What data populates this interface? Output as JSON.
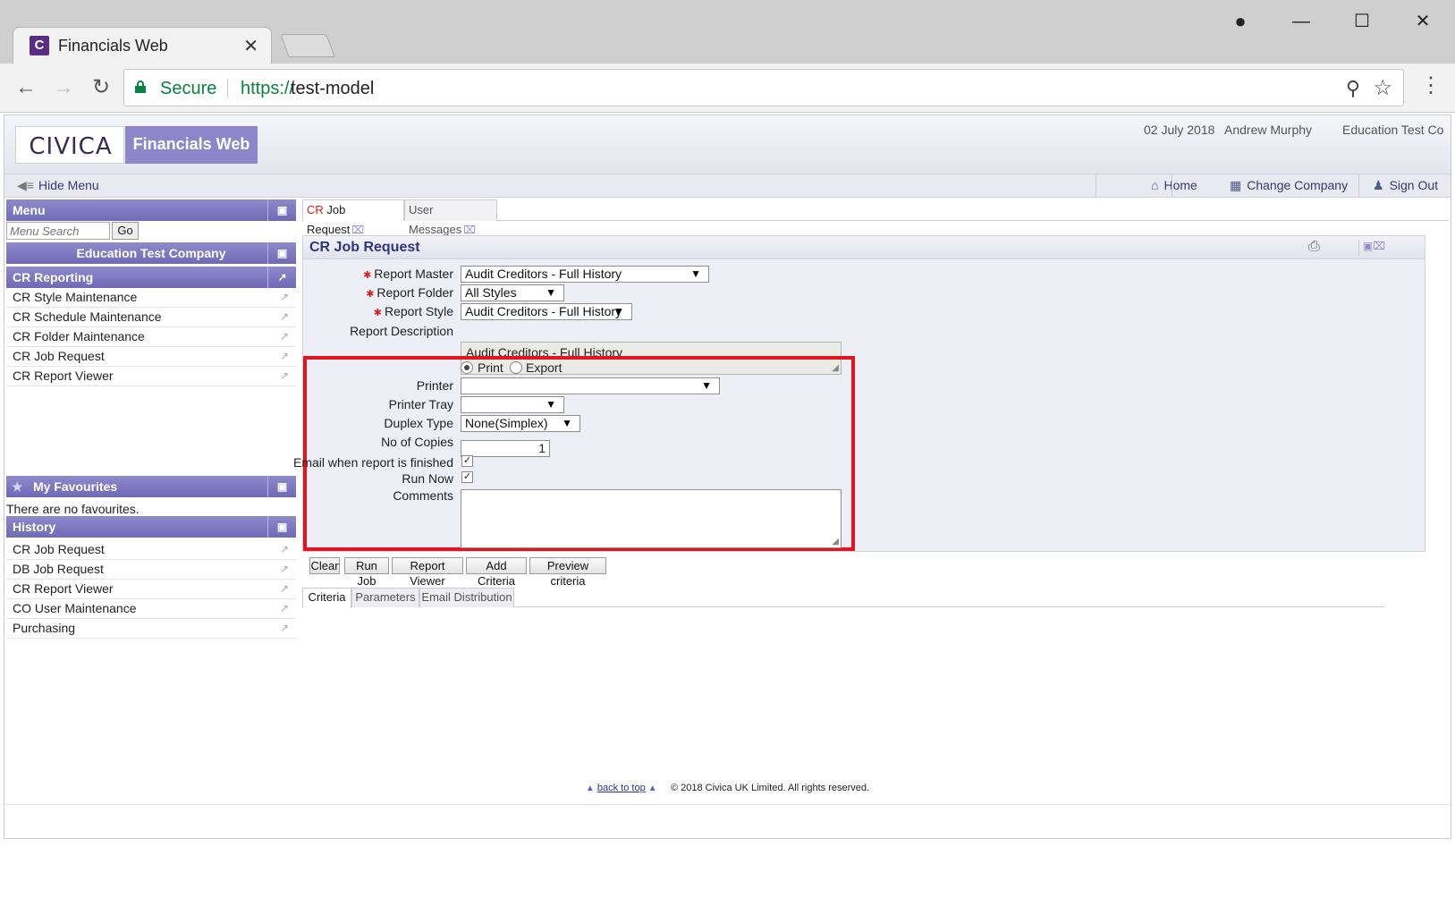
{
  "browser": {
    "tab_title": "Financials Web",
    "favicon_letter": "C",
    "close_glyph": "✕",
    "secure_label": "Secure",
    "url_scheme": "https://",
    "url_host": "test-model"
  },
  "header": {
    "logo_text": "CIVICA",
    "product_name": "Financials Web",
    "date": "02 July 2018",
    "user": "Andrew Murphy",
    "company": "Education Test Co"
  },
  "toolbar": {
    "hide_menu": "Hide Menu",
    "home": "Home",
    "change_company": "Change Company",
    "sign_out": "Sign Out"
  },
  "sidebar": {
    "menu_title": "Menu",
    "search_placeholder": "Menu Search",
    "go_label": "Go",
    "company_title": "Education Test Company",
    "section_title": "CR Reporting",
    "items": [
      {
        "label": "CR Style Maintenance"
      },
      {
        "label": "CR Schedule Maintenance"
      },
      {
        "label": "CR Folder Maintenance"
      },
      {
        "label": "CR Job Request"
      },
      {
        "label": "CR Report Viewer"
      }
    ],
    "favourites_title": "My Favourites",
    "favourites_empty": "There are no favourites.",
    "history_title": "History",
    "history": [
      {
        "label": "CR Job Request"
      },
      {
        "label": "DB Job Request"
      },
      {
        "label": "CR Report Viewer"
      },
      {
        "label": "CO User Maintenance"
      },
      {
        "label": "Purchasing"
      }
    ]
  },
  "content": {
    "tabs": [
      {
        "prefix": "CR",
        "label": " Job Request"
      },
      {
        "label": "User Messages"
      }
    ],
    "panel_title": "CR Job Request",
    "form": {
      "report_master_label": "Report Master",
      "report_master_value": "Audit Creditors - Full History",
      "report_folder_label": "Report Folder",
      "report_folder_value": "All Styles",
      "report_style_label": "Report Style",
      "report_style_value": "Audit Creditors - Full History",
      "report_description_label": "Report Description",
      "report_description_value": "Audit Creditors - Full History",
      "output_print": "Print",
      "output_export": "Export",
      "output_selected": "Print",
      "printer_label": "Printer",
      "printer_value": "",
      "printer_tray_label": "Printer Tray",
      "printer_tray_value": "",
      "duplex_label": "Duplex Type",
      "duplex_value": "None(Simplex)",
      "copies_label": "No of Copies",
      "copies_value": "1",
      "email_label": "Email when report is finished",
      "email_checked": true,
      "run_now_label": "Run Now",
      "run_now_checked": true,
      "comments_label": "Comments",
      "comments_value": ""
    },
    "actions": [
      "Clear",
      "Run Job",
      "Report Viewer",
      "Add Criteria",
      "Preview criteria"
    ],
    "sub_tabs": [
      "Criteria",
      "Parameters",
      "Email Distribution"
    ],
    "active_sub_tab": "Criteria"
  },
  "footer": {
    "back_to_top": "back to top",
    "copyright": "© 2018 Civica UK Limited. All rights reserved."
  },
  "colors": {
    "accent_purple": "#8d87c9",
    "highlight_red": "#e0151f",
    "secure_green": "#0b8043",
    "required_red": "#d21f1f"
  }
}
